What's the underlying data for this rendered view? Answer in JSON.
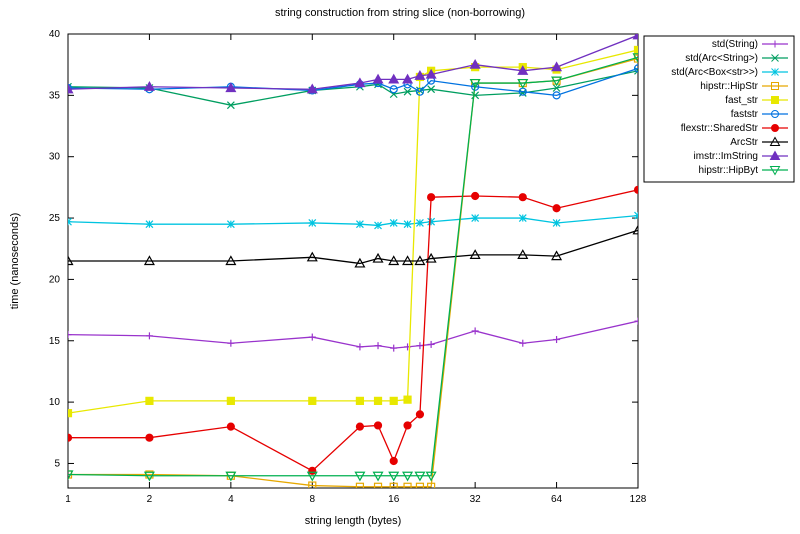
{
  "chart_data": {
    "type": "line",
    "title": "string construction from string slice (non-borrowing)",
    "xlabel": "string length (bytes)",
    "ylabel": "time (nanoseconds)",
    "xscale": "log2",
    "x": [
      1,
      2,
      4,
      8,
      12,
      14,
      16,
      18,
      20,
      22,
      32,
      48,
      64,
      128
    ],
    "xticks": [
      1,
      2,
      4,
      8,
      16,
      32,
      64,
      128
    ],
    "yticks": [
      5,
      10,
      15,
      20,
      25,
      30,
      35,
      40
    ],
    "ylim": [
      3,
      40
    ],
    "series": [
      {
        "name": "std(String)",
        "color": "#9933cc",
        "marker": "plus",
        "values": [
          15.5,
          15.4,
          14.8,
          15.3,
          14.5,
          14.6,
          14.4,
          14.5,
          14.6,
          14.7,
          15.8,
          14.8,
          15.1,
          16.6
        ]
      },
      {
        "name": "std(Arc<String>)",
        "color": "#009e60",
        "marker": "x",
        "values": [
          35.7,
          35.6,
          34.2,
          35.4,
          35.7,
          35.9,
          35.1,
          35.3,
          35.4,
          35.5,
          35.0,
          35.2,
          35.6,
          37.0
        ]
      },
      {
        "name": "std(Arc<Box<str>>)",
        "color": "#00c4e0",
        "marker": "asterisk",
        "values": [
          24.7,
          24.5,
          24.5,
          24.6,
          24.5,
          24.4,
          24.6,
          24.5,
          24.6,
          24.7,
          25.0,
          25.0,
          24.6,
          25.2
        ]
      },
      {
        "name": "hipstr::HipStr",
        "color": "#e6a800",
        "marker": "square",
        "values": [
          4.1,
          4.1,
          4.0,
          3.2,
          3.1,
          3.1,
          3.1,
          3.1,
          3.1,
          3.1,
          36.0,
          36.0,
          36.2,
          38.0
        ]
      },
      {
        "name": "fast_str",
        "color": "#e8e800",
        "marker": "square-filled",
        "values": [
          9.1,
          10.1,
          10.1,
          10.1,
          10.1,
          10.1,
          10.1,
          10.2,
          36.5,
          37.0,
          37.3,
          37.3,
          37.1,
          38.7
        ]
      },
      {
        "name": "faststr",
        "color": "#0072e0",
        "marker": "circle",
        "values": [
          35.6,
          35.5,
          35.7,
          35.4,
          35.9,
          36.0,
          35.5,
          35.9,
          35.3,
          36.2,
          35.7,
          35.3,
          35.0,
          37.2
        ]
      },
      {
        "name": "flexstr::SharedStr",
        "color": "#e60000",
        "marker": "circle-filled",
        "values": [
          7.1,
          7.1,
          8.0,
          4.4,
          8.0,
          8.1,
          5.2,
          8.1,
          9.0,
          26.7,
          26.8,
          26.7,
          25.8,
          27.3
        ]
      },
      {
        "name": "ArcStr",
        "color": "#000000",
        "marker": "triangle",
        "values": [
          21.5,
          21.5,
          21.5,
          21.8,
          21.3,
          21.7,
          21.5,
          21.5,
          21.5,
          21.7,
          22.0,
          22.0,
          21.9,
          24.0
        ]
      },
      {
        "name": "imstr::ImString",
        "color": "#7030c0",
        "marker": "triangle-filled",
        "values": [
          35.5,
          35.7,
          35.6,
          35.5,
          36.0,
          36.3,
          36.3,
          36.3,
          36.6,
          36.7,
          37.5,
          37.0,
          37.3,
          39.9
        ]
      },
      {
        "name": "hipstr::HipByt",
        "color": "#00b050",
        "marker": "triangle-down",
        "values": [
          4.1,
          4.0,
          4.0,
          4.0,
          4.0,
          4.0,
          4.0,
          4.0,
          4.0,
          4.0,
          36.0,
          36.0,
          36.2,
          38.1
        ]
      }
    ]
  }
}
